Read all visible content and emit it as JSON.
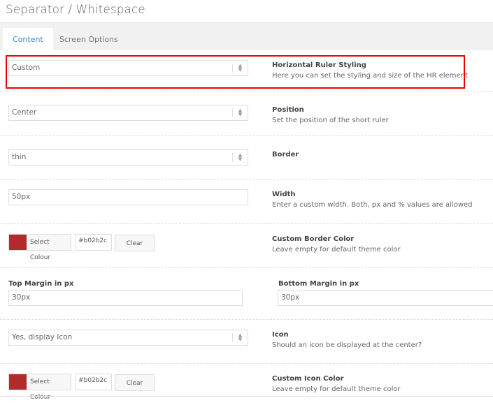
{
  "title": "Separator / Whitespace",
  "tabs": [
    "Content",
    "Screen Options"
  ],
  "rows": {
    "hr": {
      "value": "Custom",
      "label": "Horizontal Ruler Styling",
      "desc": "Here you can set the styling and size of the HR element"
    },
    "position": {
      "value": "Center",
      "label": "Position",
      "desc": "Set the position of the short ruler"
    },
    "border": {
      "value": "thin",
      "label": "Border"
    },
    "width": {
      "value": "50px",
      "label": "Width",
      "desc": "Enter a custom width. Both, px and % values are allowed"
    },
    "border_color": {
      "button": "Select Colour",
      "hex": "#b02b2c",
      "clear": "Clear",
      "label": "Custom Border Color",
      "desc": "Leave empty for default theme color"
    },
    "top_margin": {
      "label": "Top Margin in px",
      "value": "30px"
    },
    "bottom_margin": {
      "label": "Bottom Margin in px",
      "value": "30px"
    },
    "icon": {
      "value": "Yes, display Icon",
      "label": "Icon",
      "desc": "Should an icon be displayed at the center?"
    },
    "icon_color": {
      "button": "Select Colour",
      "hex": "#b02b2c",
      "clear": "Clear",
      "label": "Custom Icon Color",
      "desc": "Leave empty for default theme color"
    }
  },
  "colors": {
    "swatch": "#b02b2c",
    "accent": "#2e8fc4",
    "highlight": "#ee0000"
  }
}
